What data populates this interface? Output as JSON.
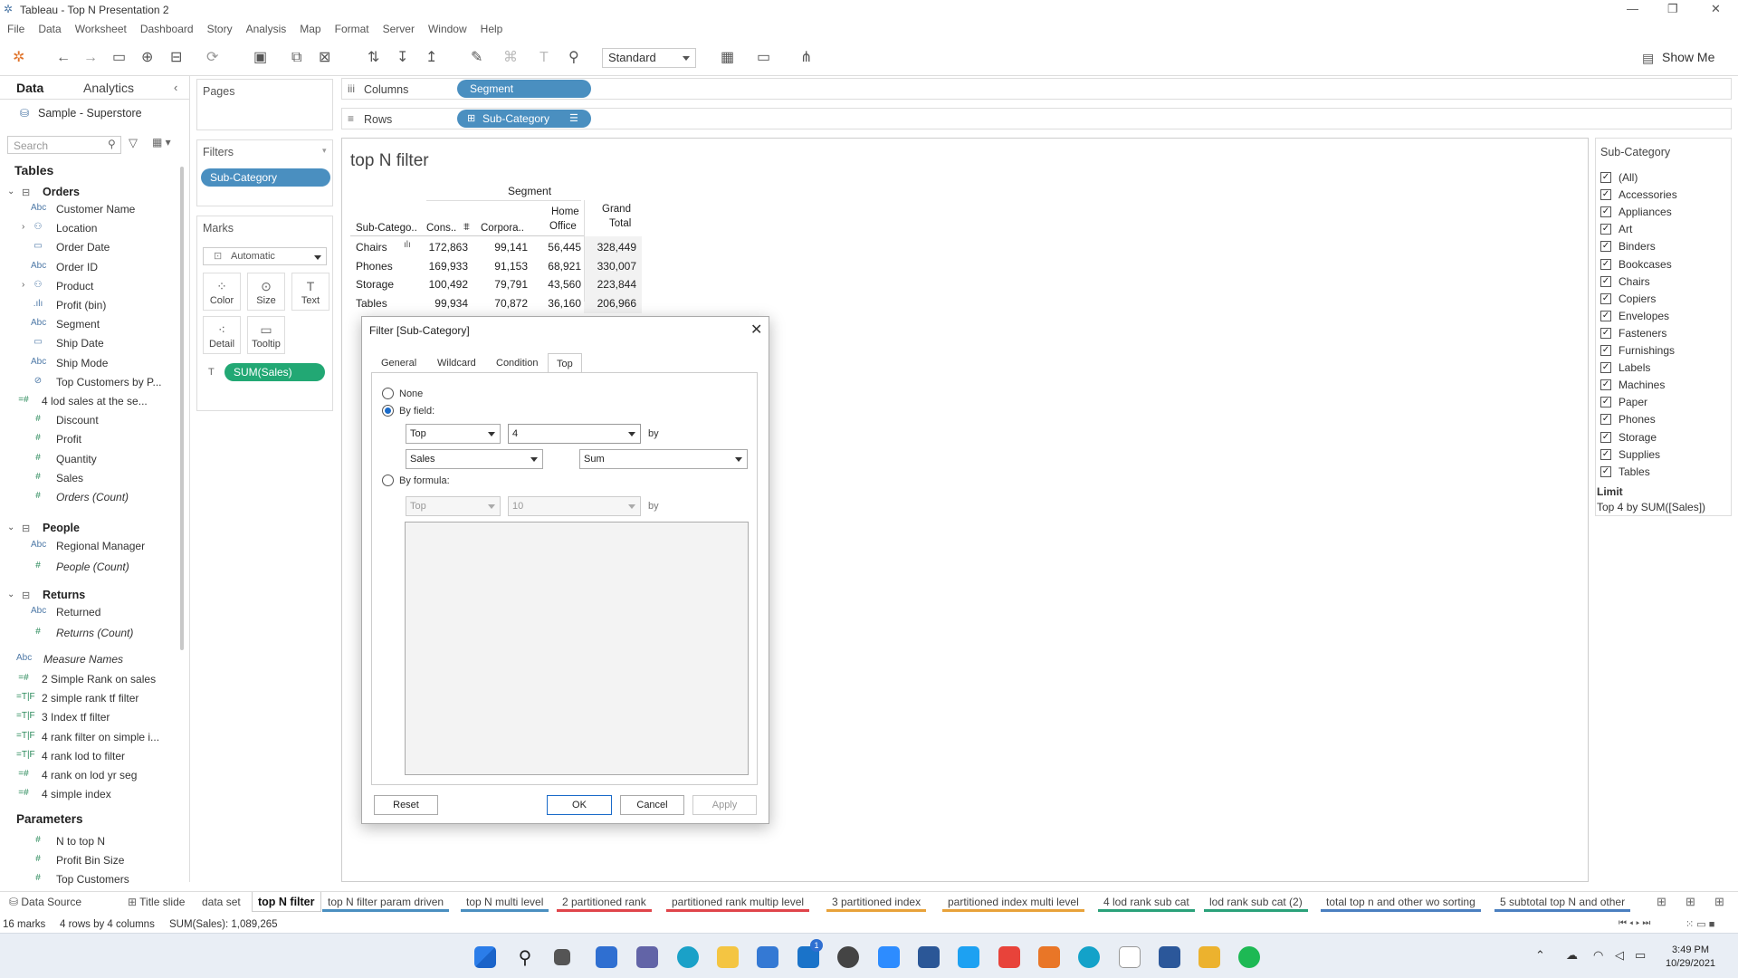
{
  "app": {
    "title": "Tableau - Top N Presentation 2"
  },
  "menu": [
    "File",
    "Data",
    "Worksheet",
    "Dashboard",
    "Story",
    "Analysis",
    "Map",
    "Format",
    "Server",
    "Window",
    "Help"
  ],
  "toolbar": {
    "view_mode": "Standard",
    "show_me": "Show Me"
  },
  "data_pane": {
    "tab_data": "Data",
    "tab_analytics": "Analytics",
    "datasource": "Sample - Superstore",
    "search_placeholder": "Search",
    "tables_title": "Tables",
    "orders_label": "Orders",
    "orders_fields": [
      {
        "icon": "Abc",
        "label": "Customer Name"
      },
      {
        "icon": "geo",
        "label": "Location"
      },
      {
        "icon": "date",
        "label": "Order Date"
      },
      {
        "icon": "Abc",
        "label": "Order ID"
      },
      {
        "icon": "hier",
        "label": "Product"
      },
      {
        "icon": "bin",
        "label": "Profit (bin)"
      },
      {
        "icon": "Abc",
        "label": "Segment"
      },
      {
        "icon": "date",
        "label": "Ship Date"
      },
      {
        "icon": "Abc",
        "label": "Ship Mode"
      },
      {
        "icon": "set",
        "label": "Top Customers by P..."
      },
      {
        "icon": "=#",
        "label": "4 lod sales at the se..."
      },
      {
        "icon": "#",
        "label": "Discount"
      },
      {
        "icon": "#",
        "label": "Profit"
      },
      {
        "icon": "#",
        "label": "Quantity"
      },
      {
        "icon": "#",
        "label": "Sales"
      },
      {
        "icon": "#",
        "label": "Orders (Count)"
      }
    ],
    "people_label": "People",
    "people_fields": [
      {
        "icon": "Abc",
        "label": "Regional Manager"
      },
      {
        "icon": "#",
        "label": "People (Count)"
      }
    ],
    "returns_label": "Returns",
    "returns_fields": [
      {
        "icon": "Abc",
        "label": "Returned"
      },
      {
        "icon": "#",
        "label": "Returns (Count)"
      }
    ],
    "measure_names": "Measure Names",
    "calc_fields": [
      {
        "icon": "=#",
        "label": "2 Simple Rank on sales"
      },
      {
        "icon": "=T|F",
        "label": "2 simple rank tf filter"
      },
      {
        "icon": "=T|F",
        "label": "3 Index tf filter"
      },
      {
        "icon": "=T|F",
        "label": "4 rank filter on simple i..."
      },
      {
        "icon": "=T|F",
        "label": "4 rank lod to filter"
      },
      {
        "icon": "=#",
        "label": "4 rank on lod yr seg"
      },
      {
        "icon": "=#",
        "label": "4 simple index"
      }
    ],
    "parameters_title": "Parameters",
    "parameters": [
      {
        "icon": "#",
        "label": "N to top N"
      },
      {
        "icon": "#",
        "label": "Profit Bin Size"
      },
      {
        "icon": "#",
        "label": "Top Customers"
      }
    ]
  },
  "shelves": {
    "pages": "Pages",
    "filters": "Filters",
    "filter_pill": "Sub-Category",
    "marks": "Marks",
    "mark_type": "Automatic",
    "color": "Color",
    "size": "Size",
    "text": "Text",
    "detail": "Detail",
    "tooltip": "Tooltip",
    "sum_sales": "SUM(Sales)",
    "columns": "Columns",
    "columns_pill": "Segment",
    "rows": "Rows",
    "rows_pill": "Sub-Category"
  },
  "viz": {
    "title": "top N filter",
    "segment_header": "Segment",
    "col_subcat": "Sub-Catego..",
    "col_cons": "Cons..",
    "col_corp": "Corpora..",
    "col_home1": "Home",
    "col_home2": "Office",
    "col_grand1": "Grand",
    "col_grand2": "Total",
    "rows": [
      {
        "cat": "Chairs",
        "cons": "172,863",
        "corp": "99,141",
        "home": "56,445",
        "total": "328,449"
      },
      {
        "cat": "Phones",
        "cons": "169,933",
        "corp": "91,153",
        "home": "68,921",
        "total": "330,007"
      },
      {
        "cat": "Storage",
        "cons": "100,492",
        "corp": "79,791",
        "home": "43,560",
        "total": "223,844"
      },
      {
        "cat": "Tables",
        "cons": "99,934",
        "corp": "70,872",
        "home": "36,160",
        "total": "206,966"
      }
    ]
  },
  "dialog": {
    "title": "Filter [Sub-Category]",
    "tabs": [
      "General",
      "Wildcard",
      "Condition",
      "Top"
    ],
    "none": "None",
    "by_field": "By field:",
    "top": "Top",
    "n": "4",
    "by": "by",
    "field": "Sales",
    "agg": "Sum",
    "by_formula": "By formula:",
    "f_top": "Top",
    "f_n": "10",
    "f_by": "by",
    "reset": "Reset",
    "ok": "OK",
    "cancel": "Cancel",
    "apply": "Apply"
  },
  "filter_card": {
    "title": "Sub-Category",
    "items": [
      "(All)",
      "Accessories",
      "Appliances",
      "Art",
      "Binders",
      "Bookcases",
      "Chairs",
      "Copiers",
      "Envelopes",
      "Fasteners",
      "Furnishings",
      "Labels",
      "Machines",
      "Paper",
      "Phones",
      "Storage",
      "Supplies",
      "Tables"
    ],
    "limit_title": "Limit",
    "limit_text": "Top 4 by SUM([Sales])"
  },
  "sheet_tabs": [
    {
      "label": "Data Source"
    },
    {
      "label": "Title slide"
    },
    {
      "label": "data set"
    },
    {
      "label": "top N filter",
      "active": true
    },
    {
      "label": "top N filter param driven"
    },
    {
      "label": "top N multi level"
    },
    {
      "label": "2 partitioned  rank"
    },
    {
      "label": "partitioned  rank multip level"
    },
    {
      "label": "3 partitioned  index"
    },
    {
      "label": "partitioned  index multi level"
    },
    {
      "label": "4 lod rank sub cat"
    },
    {
      "label": "lod rank sub cat (2)"
    },
    {
      "label": "total top n and other wo sorting"
    },
    {
      "label": "5 subtotal top N and other"
    }
  ],
  "status": {
    "marks": "16 marks",
    "dims": "4 rows by 4 columns",
    "sum": "SUM(Sales): 1,089,265"
  },
  "taskbar": {
    "time": "3:49 PM",
    "date": "10/29/2021",
    "mail_badge": "1"
  }
}
